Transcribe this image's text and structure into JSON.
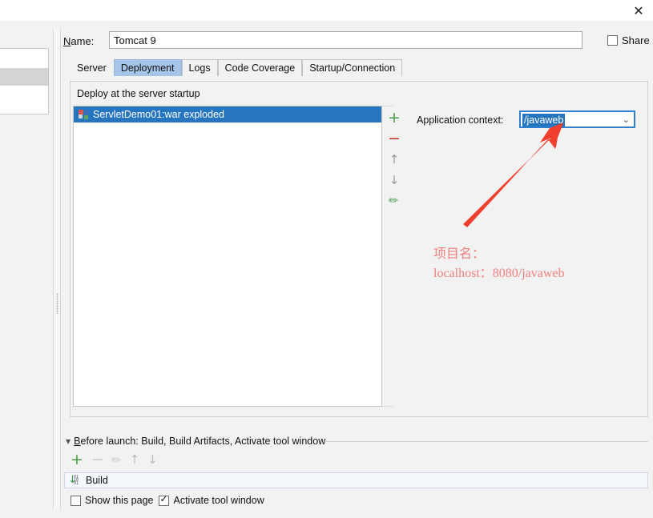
{
  "window": {
    "close_icon": "close-icon",
    "close_glyph": "✕"
  },
  "name_row": {
    "label_prefix": "N",
    "label_rest": "ame:",
    "value": "Tomcat 9",
    "share_label": "Share",
    "share_checked": false
  },
  "tabs": [
    {
      "label": "Server",
      "selected": false
    },
    {
      "label": "Deployment",
      "selected": true
    },
    {
      "label": "Logs",
      "selected": false
    },
    {
      "label": "Code Coverage",
      "selected": false
    },
    {
      "label": "Startup/Connection",
      "selected": false
    }
  ],
  "deployment": {
    "group_title": "Deploy at the server startup",
    "items": [
      {
        "label": "ServletDemo01:war exploded",
        "selected": true,
        "icon": "artifact-icon"
      }
    ],
    "toolbar": [
      {
        "name": "add-button",
        "glyph": "+",
        "enabled": true
      },
      {
        "name": "remove-button",
        "glyph": "−",
        "enabled": true
      },
      {
        "name": "move-up-button",
        "glyph": "↑",
        "enabled": false
      },
      {
        "name": "move-down-button",
        "glyph": "↓",
        "enabled": false
      },
      {
        "name": "edit-button",
        "glyph": "✎",
        "enabled": true
      }
    ],
    "application_context": {
      "label": "Application context:",
      "value": "/javaweb",
      "dropdown_glyph": "⌄"
    }
  },
  "annotation": {
    "line1": "项目名：",
    "line2": "localhost：8080/javaweb",
    "color": "#f08080",
    "arrow_color": "#f03f2e"
  },
  "before_launch": {
    "triangle_glyph": "▼",
    "title_prefix": "B",
    "title_rest": "efore launch: Build, Build Artifacts, Activate tool window",
    "toolbar": [
      {
        "name": "add-task-button",
        "glyph": "+",
        "enabled": true
      },
      {
        "name": "remove-task-button",
        "glyph": "−",
        "enabled": false
      },
      {
        "name": "edit-task-button",
        "glyph": "✎",
        "enabled": false
      },
      {
        "name": "task-move-up-button",
        "glyph": "↑",
        "enabled": false
      },
      {
        "name": "task-move-down-button",
        "glyph": "↓",
        "enabled": false
      }
    ],
    "tasks": [
      {
        "label": "Build",
        "icon": "build-icon",
        "bits": "01\n10\n01"
      }
    ],
    "show_page_label": "Show this page",
    "show_page_checked": false,
    "activate_tool_window_label": "Activate tool window",
    "activate_tool_window_checked": true
  },
  "colors": {
    "selection_blue": "#2675bf",
    "tab_selected": "#a5c5e8",
    "focus_border": "#2f7fd0",
    "background": "#f2f2f2",
    "green_icon": "#4a9c4a",
    "red_icon": "#c0392b"
  }
}
